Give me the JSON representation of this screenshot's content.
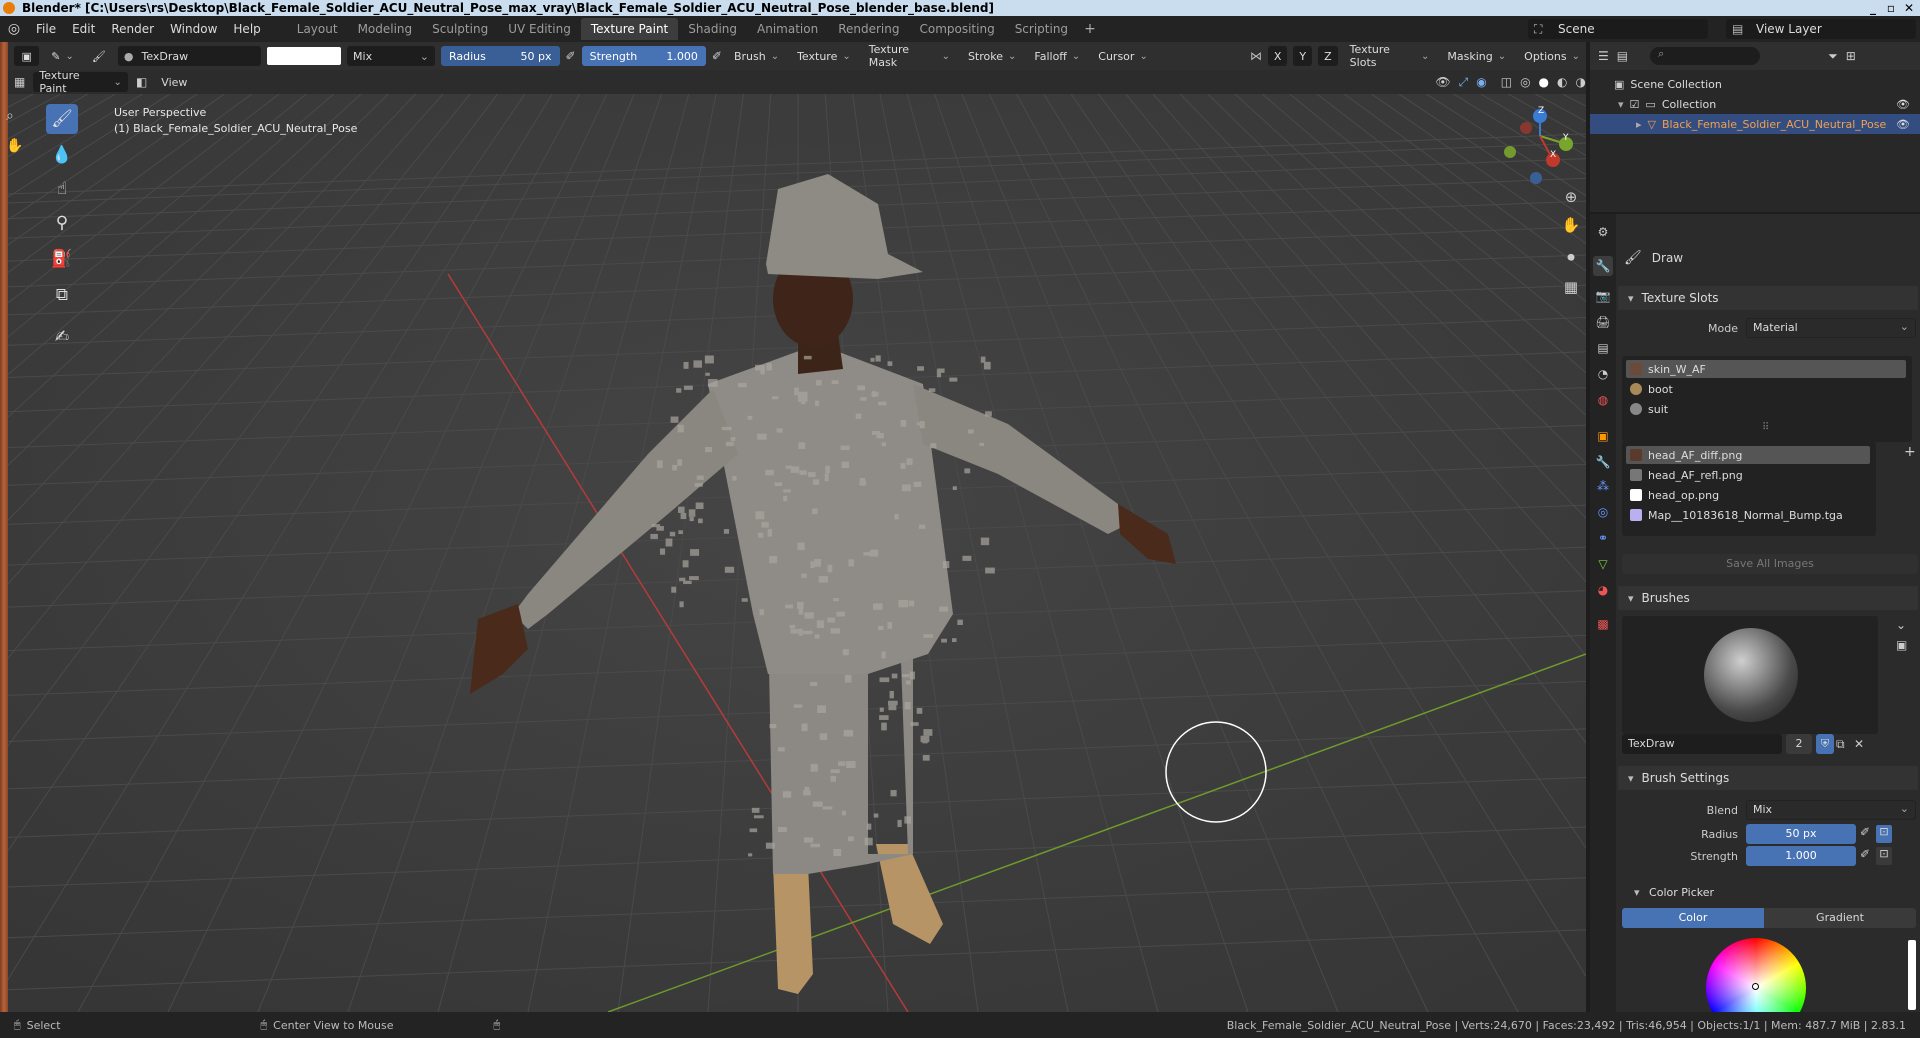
{
  "window": {
    "title": "Blender* [C:\\Users\\rs\\Desktop\\Black_Female_Soldier_ACU_Neutral_Pose_max_vray\\Black_Female_Soldier_ACU_Neutral_Pose_blender_base.blend]"
  },
  "menu": [
    "File",
    "Edit",
    "Render",
    "Window",
    "Help"
  ],
  "workspaces": [
    {
      "label": "Layout",
      "active": false
    },
    {
      "label": "Modeling",
      "active": false
    },
    {
      "label": "Sculpting",
      "active": false
    },
    {
      "label": "UV Editing",
      "active": false
    },
    {
      "label": "Texture Paint",
      "active": true
    },
    {
      "label": "Shading",
      "active": false
    },
    {
      "label": "Animation",
      "active": false
    },
    {
      "label": "Rendering",
      "active": false
    },
    {
      "label": "Compositing",
      "active": false
    },
    {
      "label": "Scripting",
      "active": false
    }
  ],
  "scene": {
    "name": "Scene",
    "view_layer": "View Layer"
  },
  "toolheader": {
    "brush_name": "TexDraw",
    "blend_mode": "Mix",
    "radius_label": "Radius",
    "radius_value": "50 px",
    "strength_label": "Strength",
    "strength_value": "1.000",
    "menus": [
      "Brush",
      "Texture",
      "Texture Mask",
      "Stroke",
      "Falloff",
      "Cursor"
    ],
    "axes": [
      "X",
      "Y",
      "Z"
    ],
    "right_menus": [
      "Texture Slots",
      "Masking",
      "Options"
    ]
  },
  "subheader": {
    "mode": "Texture Paint",
    "view": "View"
  },
  "viewport": {
    "perspective": "User Perspective",
    "object_label": "(1) Black_Female_Soldier_ACU_Neutral_Pose",
    "gizmo_labels": [
      "Z",
      "Y",
      "X"
    ]
  },
  "outliner": {
    "root": "Scene Collection",
    "collection": "Collection",
    "object": "Black_Female_Soldier_ACU_Neutral_Pose"
  },
  "properties": {
    "tool_name": "Draw",
    "texture_slots": {
      "header": "Texture Slots",
      "mode_label": "Mode",
      "mode_value": "Material",
      "materials": [
        "skin_W_AF",
        "boot",
        "suit"
      ],
      "images": [
        "head_AF_diff.png",
        "head_AF_refl.png",
        "head_op.png",
        "Map__10183618_Normal_Bump.tga"
      ],
      "save_button": "Save All Images"
    },
    "brushes": {
      "header": "Brushes",
      "brush_name": "TexDraw",
      "user_count": "2"
    },
    "brush_settings": {
      "header": "Brush Settings",
      "blend_label": "Blend",
      "blend_value": "Mix",
      "radius_label": "Radius",
      "radius_value": "50 px",
      "strength_label": "Strength",
      "strength_value": "1.000"
    },
    "color_picker": {
      "header": "Color Picker",
      "tabs": [
        "Color",
        "Gradient"
      ]
    }
  },
  "statusbar": {
    "select": "Select",
    "center": "Center View to Mouse",
    "stats": "Black_Female_Soldier_ACU_Neutral_Pose | Verts:24,670 | Faces:23,492 | Tris:46,954 | Objects:1/1 | Mem: 487.7 MiB | 2.83.1"
  },
  "colors": {
    "accent": "#4772b3",
    "selected_object": "#f0a050",
    "viewport_bg": "#3d3d3d",
    "x_axis": "#c0392b",
    "y_axis": "#7aa52d",
    "z_axis": "#3a7bd5"
  }
}
